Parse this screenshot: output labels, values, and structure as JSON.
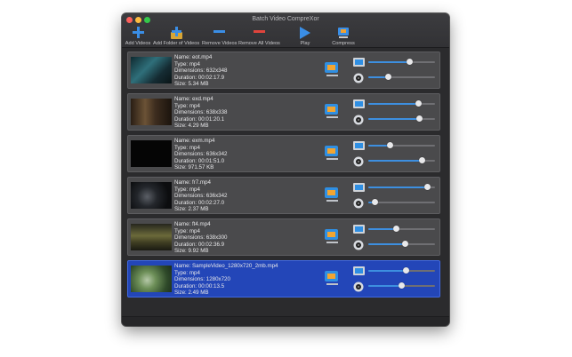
{
  "window": {
    "title": "Batch Video CompreXor"
  },
  "toolbar": {
    "add_videos": "Add Videos",
    "add_folder": "Add Folder of Videos",
    "remove_videos": "Remove Videos",
    "remove_all": "Remove All Videos",
    "play": "Play",
    "compress": "Compress"
  },
  "videos": [
    {
      "name": "Name: eot.mp4",
      "type": "Type: mp4",
      "dimensions": "Dimensions: 632x348",
      "duration": "Duration: 00:02:17.9",
      "size": "Size: 5.34 MB",
      "quality": 0.62,
      "resolution": 0.3,
      "thumb": "teal"
    },
    {
      "name": "Name: exd.mp4",
      "type": "Type: mp4",
      "dimensions": "Dimensions: 638x338",
      "duration": "Duration: 00:01:20.1",
      "size": "Size: 4.29 MB",
      "quality": 0.75,
      "resolution": 0.77,
      "thumb": "brown"
    },
    {
      "name": "Name: exm.mp4",
      "type": "Type: mp4",
      "dimensions": "Dimensions: 636x342",
      "duration": "Duration: 00:01:51.0",
      "size": "Size: 971.57 KB",
      "quality": 0.32,
      "resolution": 0.8,
      "thumb": "black"
    },
    {
      "name": "Name: fr7.mp4",
      "type": "Type: mp4",
      "dimensions": "Dimensions: 636x342",
      "duration": "Duration: 00:02:27.0",
      "size": "Size: 2.37 MB",
      "quality": 0.88,
      "resolution": 0.1,
      "thumb": "dark"
    },
    {
      "name": "Name: ft4.mp4",
      "type": "Type: mp4",
      "dimensions": "Dimensions: 638x300",
      "duration": "Duration: 00:02:36.9",
      "size": "Size: 9.92 MB",
      "quality": 0.42,
      "resolution": 0.55,
      "thumb": "olive"
    },
    {
      "name": "Name: SampleVideo_1280x720_2mb.mp4",
      "type": "Type: mp4",
      "dimensions": "Dimensions: 1280x720",
      "duration": "Duration: 00:00:13.5",
      "size": "Size: 2.49 MB",
      "quality": 0.57,
      "resolution": 0.5,
      "thumb": "green",
      "selected": true
    }
  ]
}
